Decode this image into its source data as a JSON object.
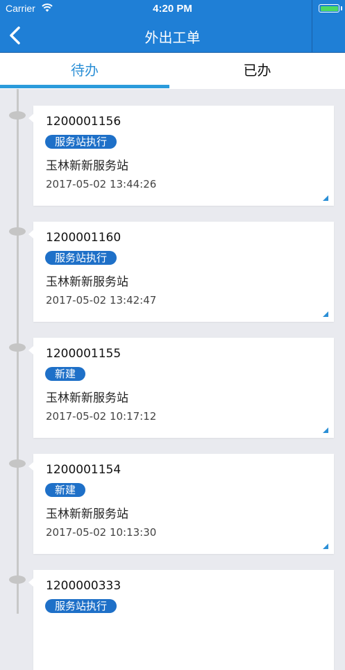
{
  "status_bar": {
    "carrier": "Carrier",
    "time": "4:20 PM",
    "battery_level": 1.0
  },
  "header": {
    "title": "外出工单"
  },
  "tabs": [
    {
      "label": "待办",
      "active": true
    },
    {
      "label": "已办",
      "active": false
    }
  ],
  "colors": {
    "header_bg": "#1f7fd6",
    "tab_active": "#2b8fd6",
    "tag_bg": "#1e70c8",
    "page_bg": "#e9eaef"
  },
  "orders": [
    {
      "id": "1200001156",
      "status": "服务站执行",
      "station": "玉林新新服务站",
      "time": "2017-05-02 13:44:26"
    },
    {
      "id": "1200001160",
      "status": "服务站执行",
      "station": "玉林新新服务站",
      "time": "2017-05-02 13:42:47"
    },
    {
      "id": "1200001155",
      "status": "新建",
      "station": "玉林新新服务站",
      "time": "2017-05-02 10:17:12"
    },
    {
      "id": "1200001154",
      "status": "新建",
      "station": "玉林新新服务站",
      "time": "2017-05-02 10:13:30"
    },
    {
      "id": "1200000333",
      "status": "服务站执行"
    }
  ],
  "icons": {
    "back": "chevron-left-icon",
    "wifi": "wifi-icon",
    "battery": "battery-icon",
    "corner": "corner-triangle-icon"
  }
}
